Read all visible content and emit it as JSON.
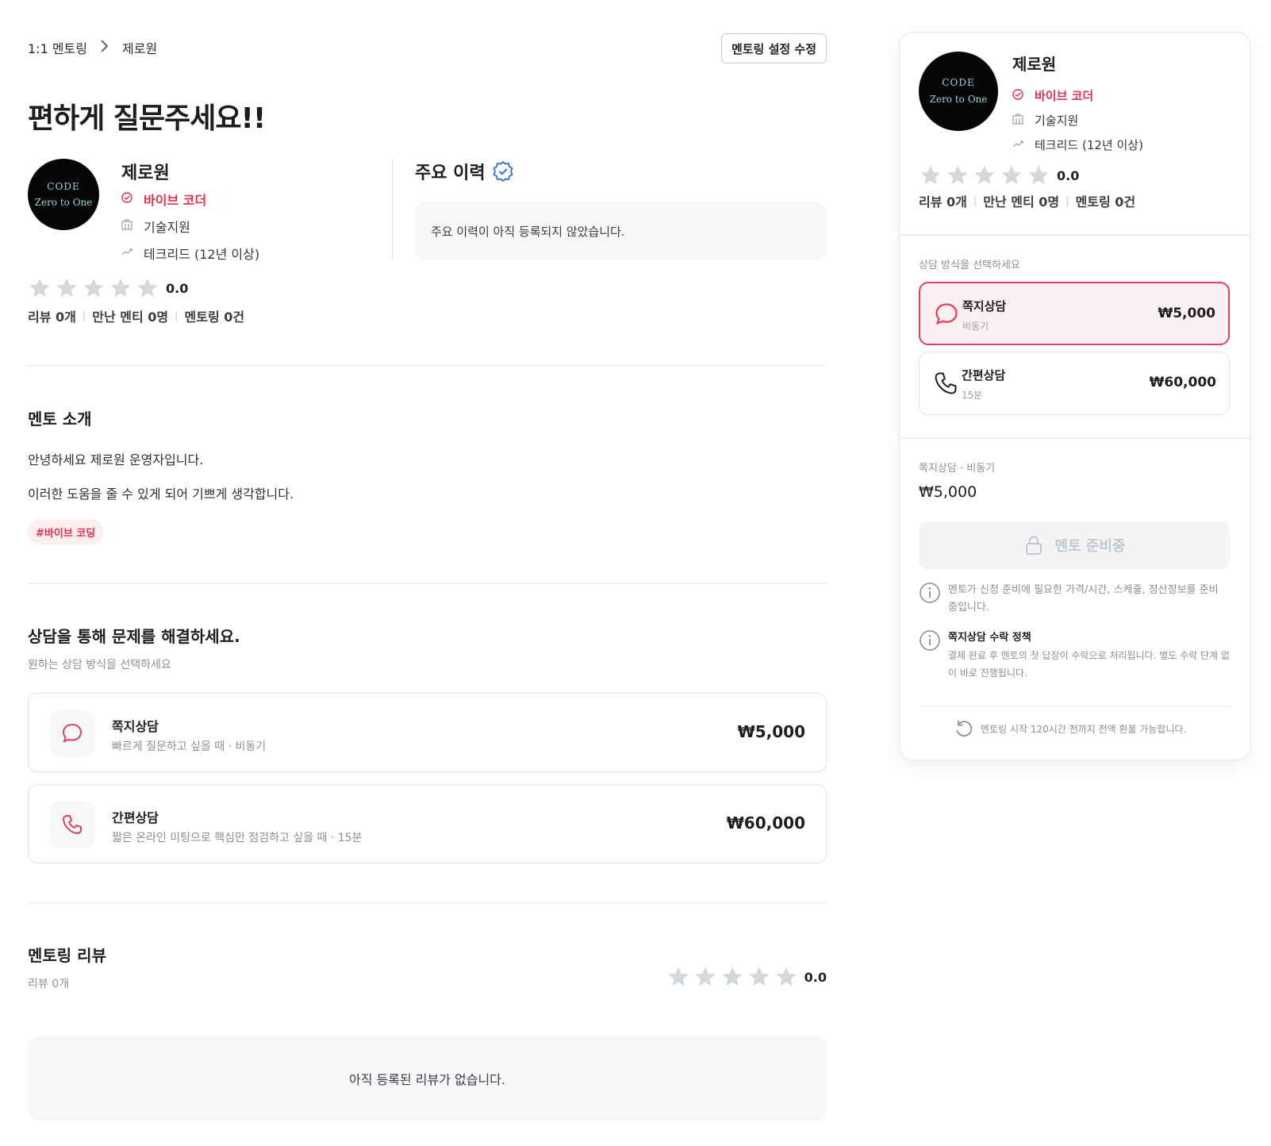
{
  "breadcrumb": {
    "root": "1:1 멘토링",
    "current": "제로원"
  },
  "edit_button": "멘토링 설정 수정",
  "page_title": "편하게 질문주세요!!",
  "mentor": {
    "logo_line1": "CODE",
    "logo_line2": "Zero to One",
    "name": "제로원",
    "badge": "바이브 코더",
    "field": "기술지원",
    "career": "테크리드 (12년 이상)",
    "rating": "0.0",
    "reviews": "리뷰 0개",
    "mentees": "만난 멘티 0명",
    "mentorings": "멘토링 0건"
  },
  "history": {
    "title": "주요 이력",
    "empty": "주요 이력이 아직 등록되지 않았습니다."
  },
  "intro": {
    "title": "멘토 소개",
    "line1": "안녕하세요 제로원 운영자입니다.",
    "line2": "이러한 도움을 줄 수 있게 되어 기쁘게 생각합니다.",
    "tag": "#바이브 코딩"
  },
  "consult": {
    "title": "상담을 통해 문제를 해결하세요.",
    "subtitle": "원하는 상담 방식을 선택하세요",
    "options": [
      {
        "name": "쪽지상담",
        "desc": "빠르게 질문하고 싶을 때 · 비동기",
        "price": "₩5,000",
        "short_desc": "비동기",
        "icon": "chat-bubble-icon"
      },
      {
        "name": "간편상담",
        "desc": "짧은 온라인 미팅으로 핵심만 점검하고 싶을 때 · 15분",
        "price": "₩60,000",
        "short_desc": "15분",
        "icon": "phone-icon"
      }
    ]
  },
  "reviews": {
    "title": "멘토링 리뷰",
    "count": "리뷰 0개",
    "rating": "0.0",
    "empty": "아직 등록된 리뷰가 없습니다."
  },
  "side": {
    "select_label": "상담 방식을 선택하세요",
    "summary_label": "쪽지상담 · 비동기",
    "summary_price": "₩5,000",
    "cta": "멘토 준비중",
    "info1": "멘토가 신청 준비에 필요한 가격/시간, 스케줄, 정산정보를 준비 중입니다.",
    "policy_title": "쪽지상담 수락 정책",
    "policy_text": "결제 완료 후 멘토의 첫 답장이 수락으로 처리됩니다. 별도 수락 단계 없이 바로 진행됩니다.",
    "refund": "멘토링 시작 120시간 전까지 전액 환불 가능합니다."
  },
  "colors": {
    "accent": "#e0314f",
    "verified": "#2f6fe4",
    "star_empty": "#d4d7db"
  }
}
